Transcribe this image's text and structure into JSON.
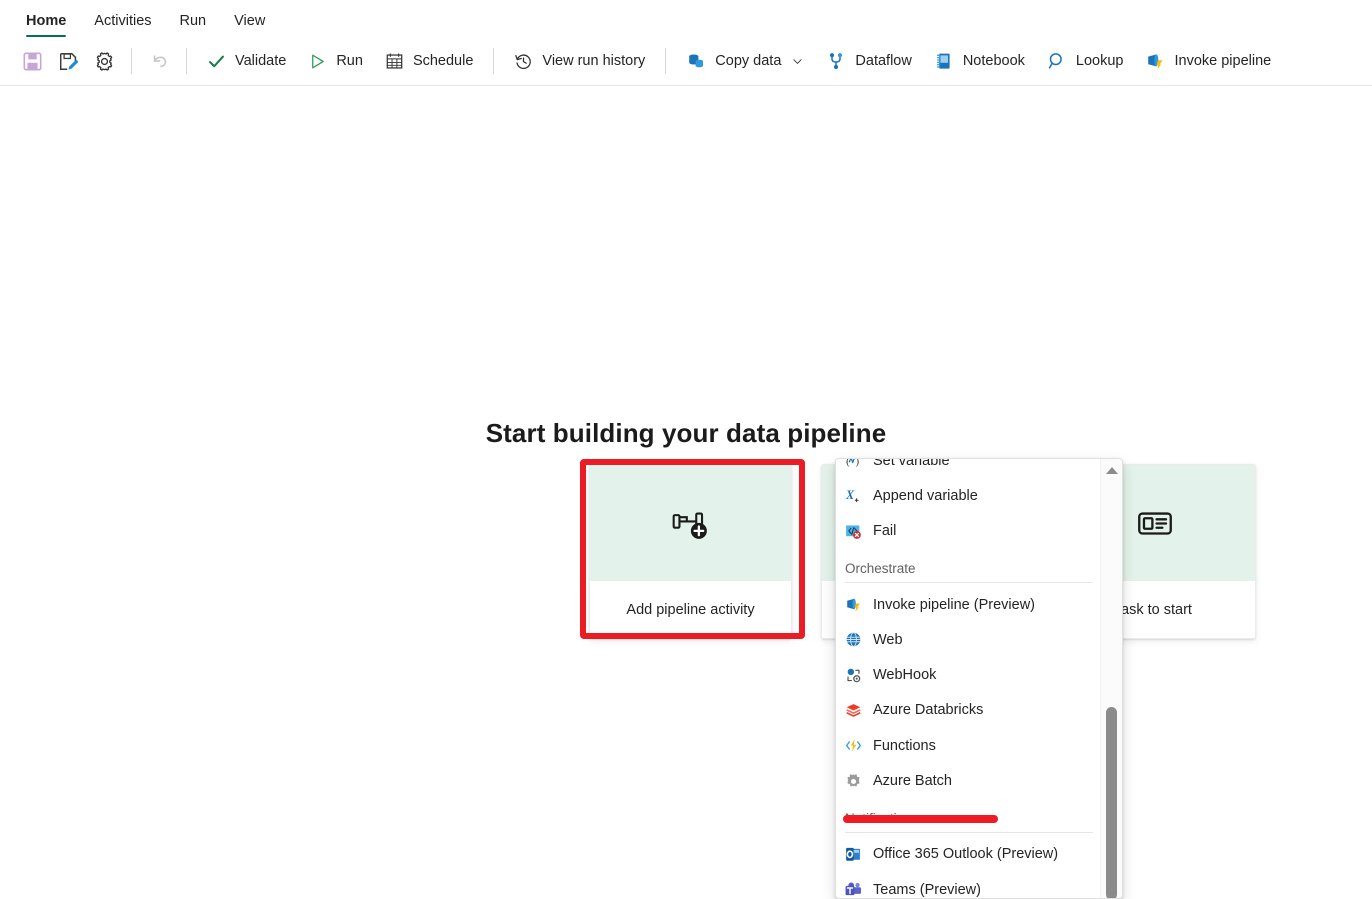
{
  "ribbon": {
    "tabs": [
      {
        "label": "Home",
        "active": true
      },
      {
        "label": "Activities",
        "active": false
      },
      {
        "label": "Run",
        "active": false
      },
      {
        "label": "View",
        "active": false
      }
    ],
    "accent_color": "#0f6b5c"
  },
  "toolbar": {
    "save_icon": "save-icon",
    "save_as_icon": "save-as-icon",
    "settings_icon": "gear-icon",
    "undo_icon": "undo-icon",
    "validate_label": "Validate",
    "validate_icon": "checkmark-icon",
    "run_label": "Run",
    "run_icon": "play-icon",
    "schedule_label": "Schedule",
    "schedule_icon": "calendar-icon",
    "view_run_history_label": "View run history",
    "view_run_history_icon": "history-clock-icon",
    "copy_data_label": "Copy data",
    "copy_data_icon": "database-copy-icon",
    "copy_data_chevron": "chevron-down-icon",
    "dataflow_label": "Dataflow",
    "dataflow_icon": "dataflow-branch-icon",
    "notebook_label": "Notebook",
    "notebook_icon": "notebook-icon",
    "lookup_label": "Lookup",
    "lookup_icon": "magnifier-icon",
    "invoke_pipeline_label": "Invoke pipeline",
    "invoke_pipeline_icon": "invoke-pipeline-icon"
  },
  "canvas": {
    "heading": "Start building your data pipeline",
    "cards": [
      {
        "label": "Add pipeline activity",
        "icon": "add-pipeline-activity-icon",
        "highlighted": true
      },
      {
        "label": "",
        "icon": "copy-data-assistant-icon",
        "highlighted": false
      },
      {
        "label": "task to start",
        "icon": "template-card-icon",
        "highlighted": false
      }
    ],
    "highlight_color": "#ec1c24"
  },
  "flyout": {
    "top_clipped_item": {
      "label": "Set variable",
      "icon": "set-variable-icon"
    },
    "items": [
      {
        "type": "item",
        "label": "Append variable",
        "icon": "append-variable-icon"
      },
      {
        "type": "item",
        "label": "Fail",
        "icon": "fail-icon"
      },
      {
        "type": "group",
        "label": "Orchestrate"
      },
      {
        "type": "item",
        "label": "Invoke pipeline (Preview)",
        "icon": "invoke-pipeline-icon"
      },
      {
        "type": "item",
        "label": "Web",
        "icon": "web-globe-icon"
      },
      {
        "type": "item",
        "label": "WebHook",
        "icon": "webhook-icon"
      },
      {
        "type": "item",
        "label": "Azure Databricks",
        "icon": "azure-databricks-icon"
      },
      {
        "type": "item",
        "label": "Functions",
        "icon": "azure-functions-icon"
      },
      {
        "type": "item",
        "label": "Azure Batch",
        "icon": "azure-batch-icon"
      },
      {
        "type": "group",
        "label": "Notifications"
      },
      {
        "type": "item",
        "label": "Office 365 Outlook (Preview)",
        "icon": "outlook-icon"
      },
      {
        "type": "item",
        "label": "Teams (Preview)",
        "icon": "teams-icon"
      }
    ],
    "annotation": {
      "target": "Azure Databricks",
      "color": "#ee1b24"
    },
    "scrollbar": {
      "up_arrow": "scroll-up-arrow-icon",
      "thumb_color": "#8b8b8b"
    }
  }
}
